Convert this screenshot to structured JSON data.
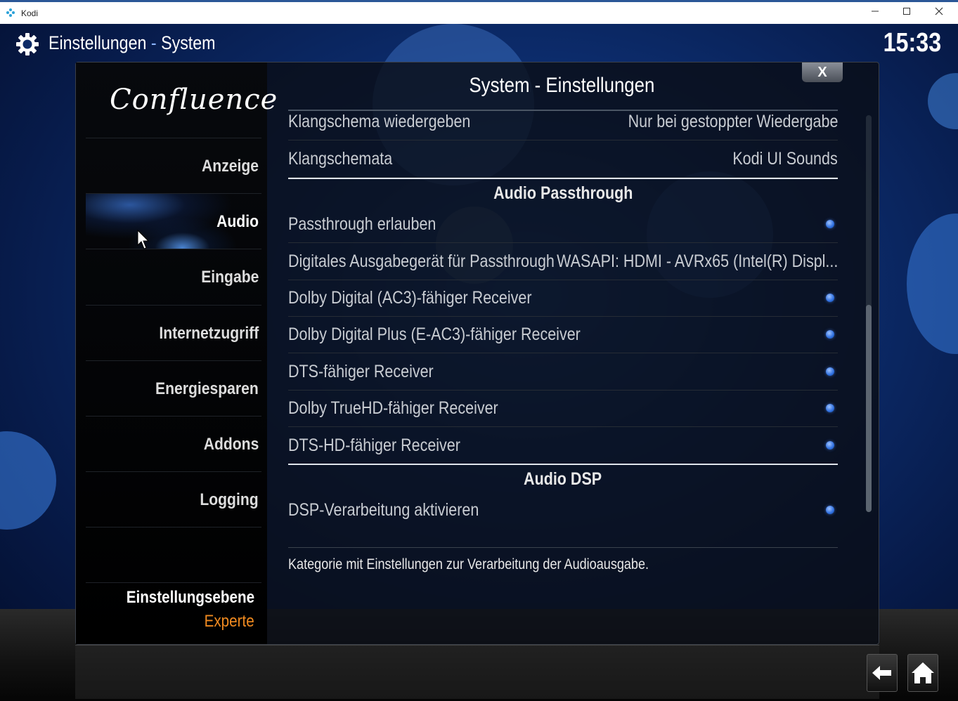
{
  "window": {
    "title": "Kodi"
  },
  "header": {
    "section": "Einstellungen",
    "separator": "-",
    "subsection": "System",
    "clock": "15:33"
  },
  "sidebar": {
    "logo": "Confluence",
    "items": [
      {
        "label": "Anzeige"
      },
      {
        "label": "Audio"
      },
      {
        "label": "Eingabe"
      },
      {
        "label": "Internetzugriff"
      },
      {
        "label": "Energiesparen"
      },
      {
        "label": "Addons"
      },
      {
        "label": "Logging"
      }
    ],
    "active_item": "Audio",
    "settings_level_label": "Einstellungsebene",
    "settings_level_value": "Experte"
  },
  "dialog": {
    "title": "System - Einstellungen",
    "close_label": "X",
    "rows": [
      {
        "label": "Klangschema wiedergeben",
        "value": "Nur bei gestoppter Wiedergabe"
      },
      {
        "label": "Klangschemata",
        "value": "Kodi UI Sounds"
      }
    ],
    "section_passthrough": "Audio Passthrough",
    "passthrough_rows": [
      {
        "label": "Passthrough erlauben",
        "toggle": true
      },
      {
        "label": "Digitales Ausgabegerät für Passthrough",
        "value": "WASAPI: HDMI - AVRx65 (Intel(R) Displ..."
      },
      {
        "label": "Dolby Digital (AC3)-fähiger Receiver",
        "toggle": true
      },
      {
        "label": "Dolby Digital Plus (E-AC3)-fähiger Receiver",
        "toggle": true
      },
      {
        "label": "DTS-fähiger Receiver",
        "toggle": true
      },
      {
        "label": "Dolby TrueHD-fähiger Receiver",
        "toggle": true
      },
      {
        "label": "DTS-HD-fähiger Receiver",
        "toggle": true
      }
    ],
    "section_dsp": "Audio DSP",
    "dsp_rows": [
      {
        "label": "DSP-Verarbeitung aktivieren",
        "toggle": true
      }
    ],
    "description": "Kategorie mit Einstellungen zur Verarbeitung der Audioausgabe."
  },
  "colors": {
    "accent": "#2e6fe0",
    "level_value": "#f08a20"
  },
  "icons": {
    "gear": "gear-icon",
    "back": "back-arrow-icon",
    "home": "home-icon"
  }
}
